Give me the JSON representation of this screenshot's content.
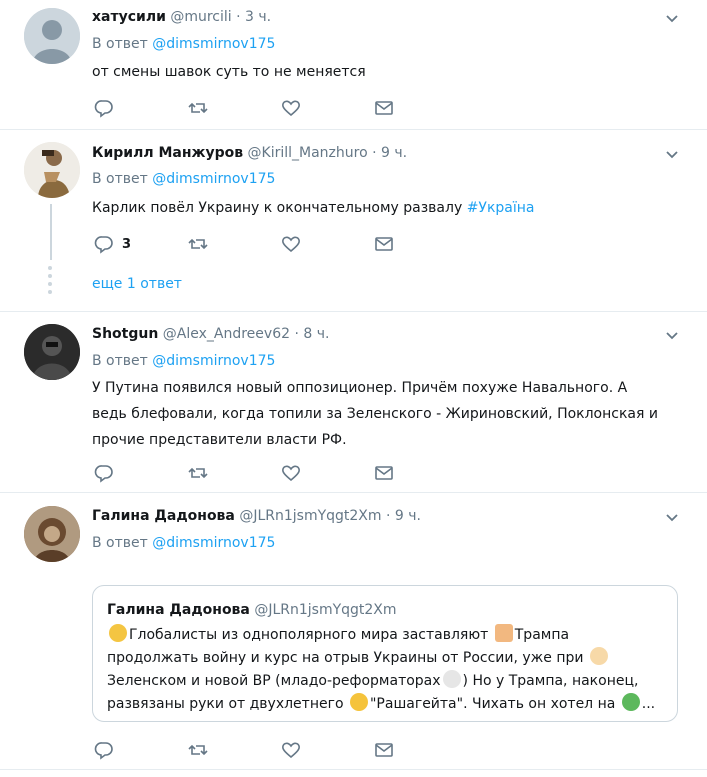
{
  "tweets": [
    {
      "name": "хатусили",
      "handle": "@murcili",
      "sep": "·",
      "time": "3 ч.",
      "reply_prefix": "В ответ",
      "reply_mention": "@dimsmirnov175",
      "text": "от смены шавок суть то не меняется",
      "reply_count": ""
    },
    {
      "name": "Кирилл Манжуров",
      "handle": "@Kirill_Manzhuro",
      "sep": "·",
      "time": "9 ч.",
      "reply_prefix": "В ответ",
      "reply_mention": "@dimsmirnov175",
      "text": "Карлик повёл Украину к окончательному развалу",
      "hashtag": "#Україна",
      "reply_count": "3",
      "more_replies": "еще 1 ответ"
    },
    {
      "name": "Shotgun",
      "handle": "@Alex_Andreev62",
      "sep": "·",
      "time": "8 ч.",
      "reply_prefix": "В ответ",
      "reply_mention": "@dimsmirnov175",
      "text_lines": [
        "У Путина появился новый оппозиционер. Причём похуже Навального. А",
        "ведь блефовали, когда топили за Зеленского - Жириновский, Поклонская и",
        "прочие представители власти РФ."
      ],
      "reply_count": ""
    },
    {
      "name": "Галина Дадонова",
      "handle": "@JLRn1jsmYqgt2Xm",
      "sep": "·",
      "time": "9 ч.",
      "reply_prefix": "В ответ",
      "reply_mention": "@dimsmirnov175",
      "reply_count": "",
      "quote": {
        "name": "Галина Дадонова",
        "handle": "@JLRn1jsmYqgt2Xm",
        "line1a": "Глобалисты из однополярного мира заставляют",
        "line1b": "Трампа",
        "line2a": "продолжать войну и курс на отрыв Украины от России, уже при",
        "line3": "Зеленском и новой ВР (младо-реформаторах",
        "line3b": ") Но у Трампа, наконец,",
        "line4a": "развязаны руки от двухлетнего",
        "line4b": "\"Рашагейта\". Чихать он хотел на",
        "line4c": "..."
      }
    }
  ],
  "icons": {
    "reply": "reply-icon",
    "retweet": "retweet-icon",
    "like": "heart-icon",
    "dm": "envelope-icon",
    "caret": "chevron-down-icon"
  },
  "colors": {
    "link": "#1da1f2",
    "muted": "#657786",
    "border": "#e6ecf0"
  }
}
